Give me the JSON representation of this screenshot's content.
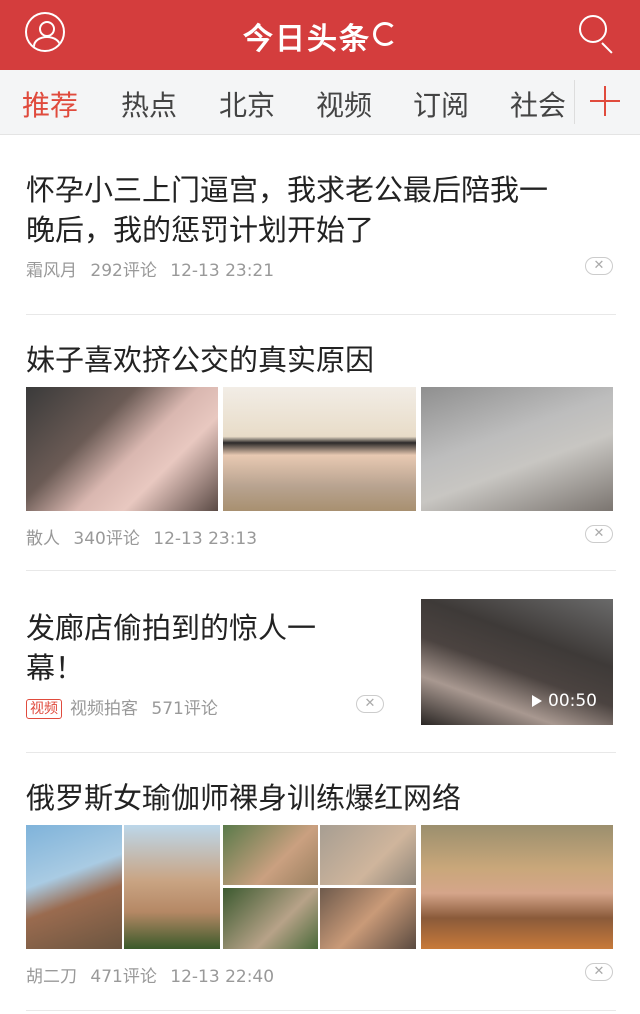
{
  "header": {
    "app_title": "今日头条",
    "avatar_icon": "user-icon",
    "search_icon": "search-icon",
    "refresh_icon": "refresh-icon",
    "bg_color": "#d43d3d"
  },
  "tabs": [
    {
      "label": "推荐",
      "active": true
    },
    {
      "label": "热点",
      "active": false
    },
    {
      "label": "北京",
      "active": false
    },
    {
      "label": "视频",
      "active": false
    },
    {
      "label": "订阅",
      "active": false
    },
    {
      "label": "社会",
      "active": false
    }
  ],
  "tab_add_icon": "plus-icon",
  "accent_color": "#e04b3d",
  "feed": [
    {
      "title_line1": "怀孕小三上门逼宫，我求老公最后陪我一",
      "title_line2": "晚后，我的惩罚计划开始了",
      "source": "霜风月",
      "comments": "292评论",
      "time": "12-13 23:21"
    },
    {
      "title": "妹子喜欢挤公交的真实原因",
      "source": "散人",
      "comments": "340评论",
      "time": "12-13 23:13"
    },
    {
      "title_line1": "发廊店偷拍到的惊人一",
      "title_line2": "幕！",
      "badge": "视频",
      "source": "视频拍客",
      "comments": "571评论",
      "duration": "00:50"
    },
    {
      "title": "俄罗斯女瑜伽师裸身训练爆红网络",
      "source": "胡二刀",
      "comments": "471评论",
      "time": "12-13 22:40"
    }
  ],
  "dismiss_icon": "close-icon"
}
